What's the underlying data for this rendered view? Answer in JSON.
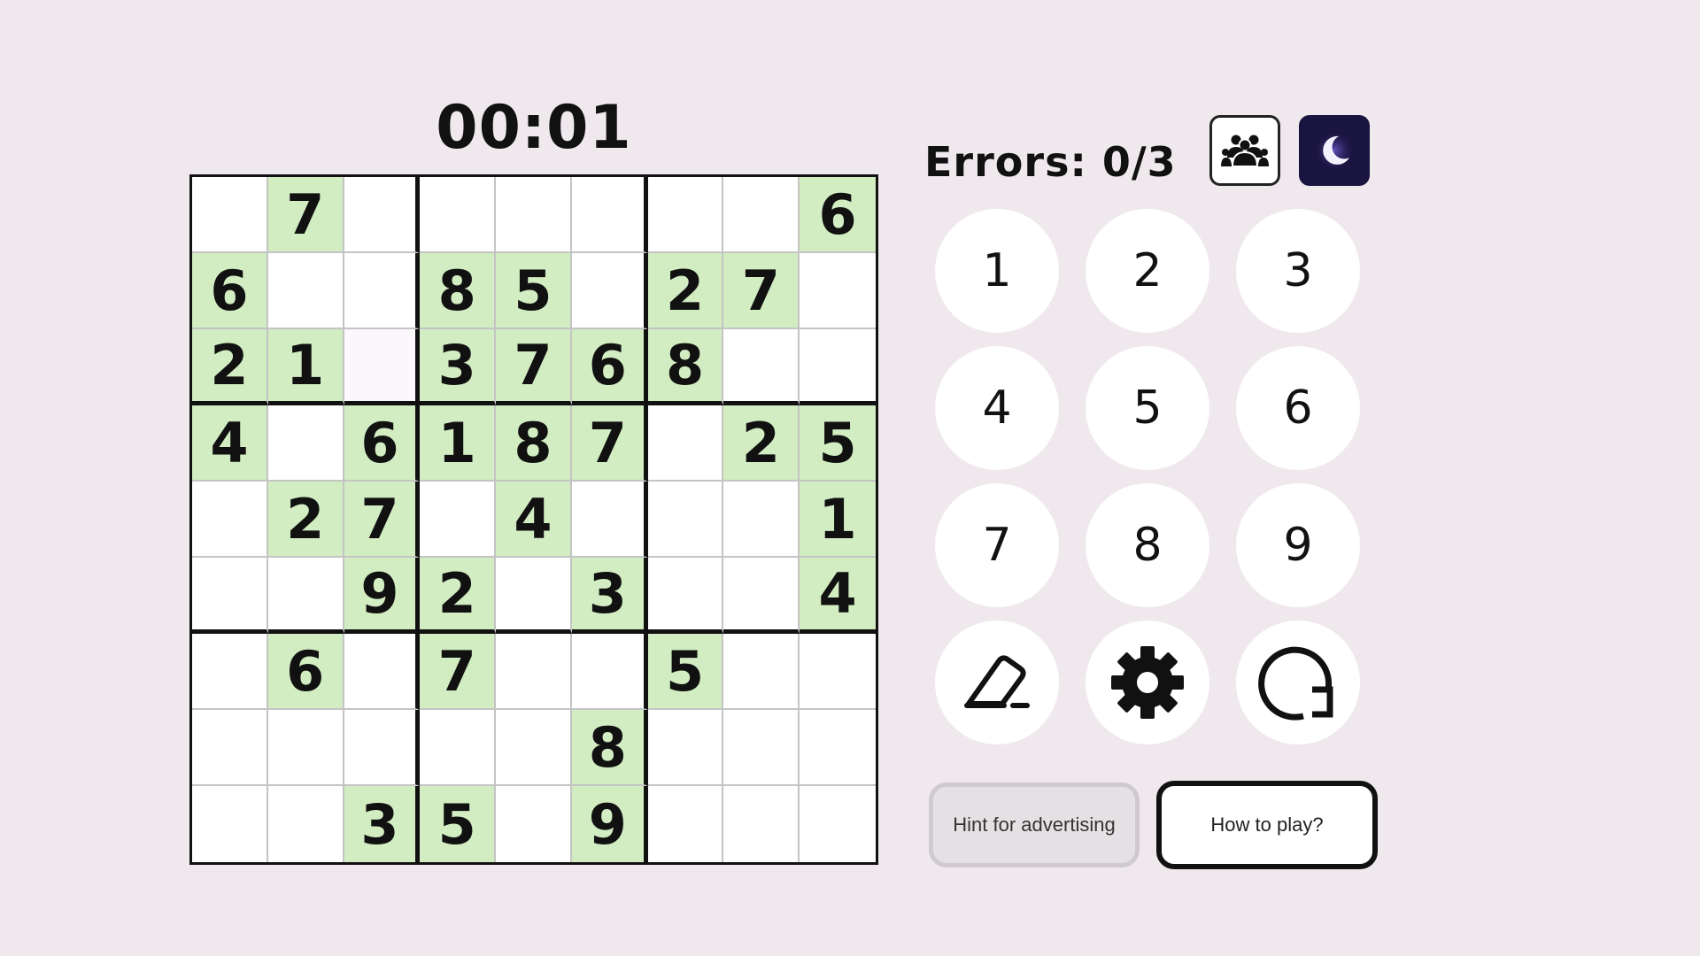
{
  "timer": "00:01",
  "errors_text": "Errors: 0/3",
  "board": [
    [
      "",
      "7",
      "",
      "",
      "",
      "",
      "",
      "",
      "6"
    ],
    [
      "6",
      "",
      "",
      "8",
      "5",
      "",
      "2",
      "7",
      ""
    ],
    [
      "2",
      "1",
      "",
      "3",
      "7",
      "6",
      "8",
      "",
      ""
    ],
    [
      "4",
      "",
      "6",
      "1",
      "8",
      "7",
      "",
      "2",
      "5"
    ],
    [
      "",
      "2",
      "7",
      "",
      "4",
      "",
      "",
      "",
      "1"
    ],
    [
      "",
      "",
      "9",
      "2",
      "",
      "3",
      "",
      "",
      "4"
    ],
    [
      "",
      "6",
      "",
      "7",
      "",
      "",
      "5",
      "",
      ""
    ],
    [
      "",
      "",
      "",
      "",
      "",
      "8",
      "",
      "",
      ""
    ],
    [
      "",
      "",
      "3",
      "5",
      "",
      "9",
      "",
      "",
      ""
    ]
  ],
  "selected_cell": {
    "row": 2,
    "col": 2
  },
  "numpad": [
    "1",
    "2",
    "3",
    "4",
    "5",
    "6",
    "7",
    "8",
    "9"
  ],
  "tools": [
    {
      "name": "eraser-icon"
    },
    {
      "name": "gear-icon"
    },
    {
      "name": "restart-icon"
    }
  ],
  "buttons": {
    "hint_label": "Hint for advertising",
    "howto_label": "How to play?"
  },
  "header_icons": {
    "friends": "group-icon",
    "theme": "moon-icon"
  },
  "colors": {
    "given_cell": "#d2edc2",
    "background": "#efe9ee",
    "theme_button": "#1a1440"
  }
}
